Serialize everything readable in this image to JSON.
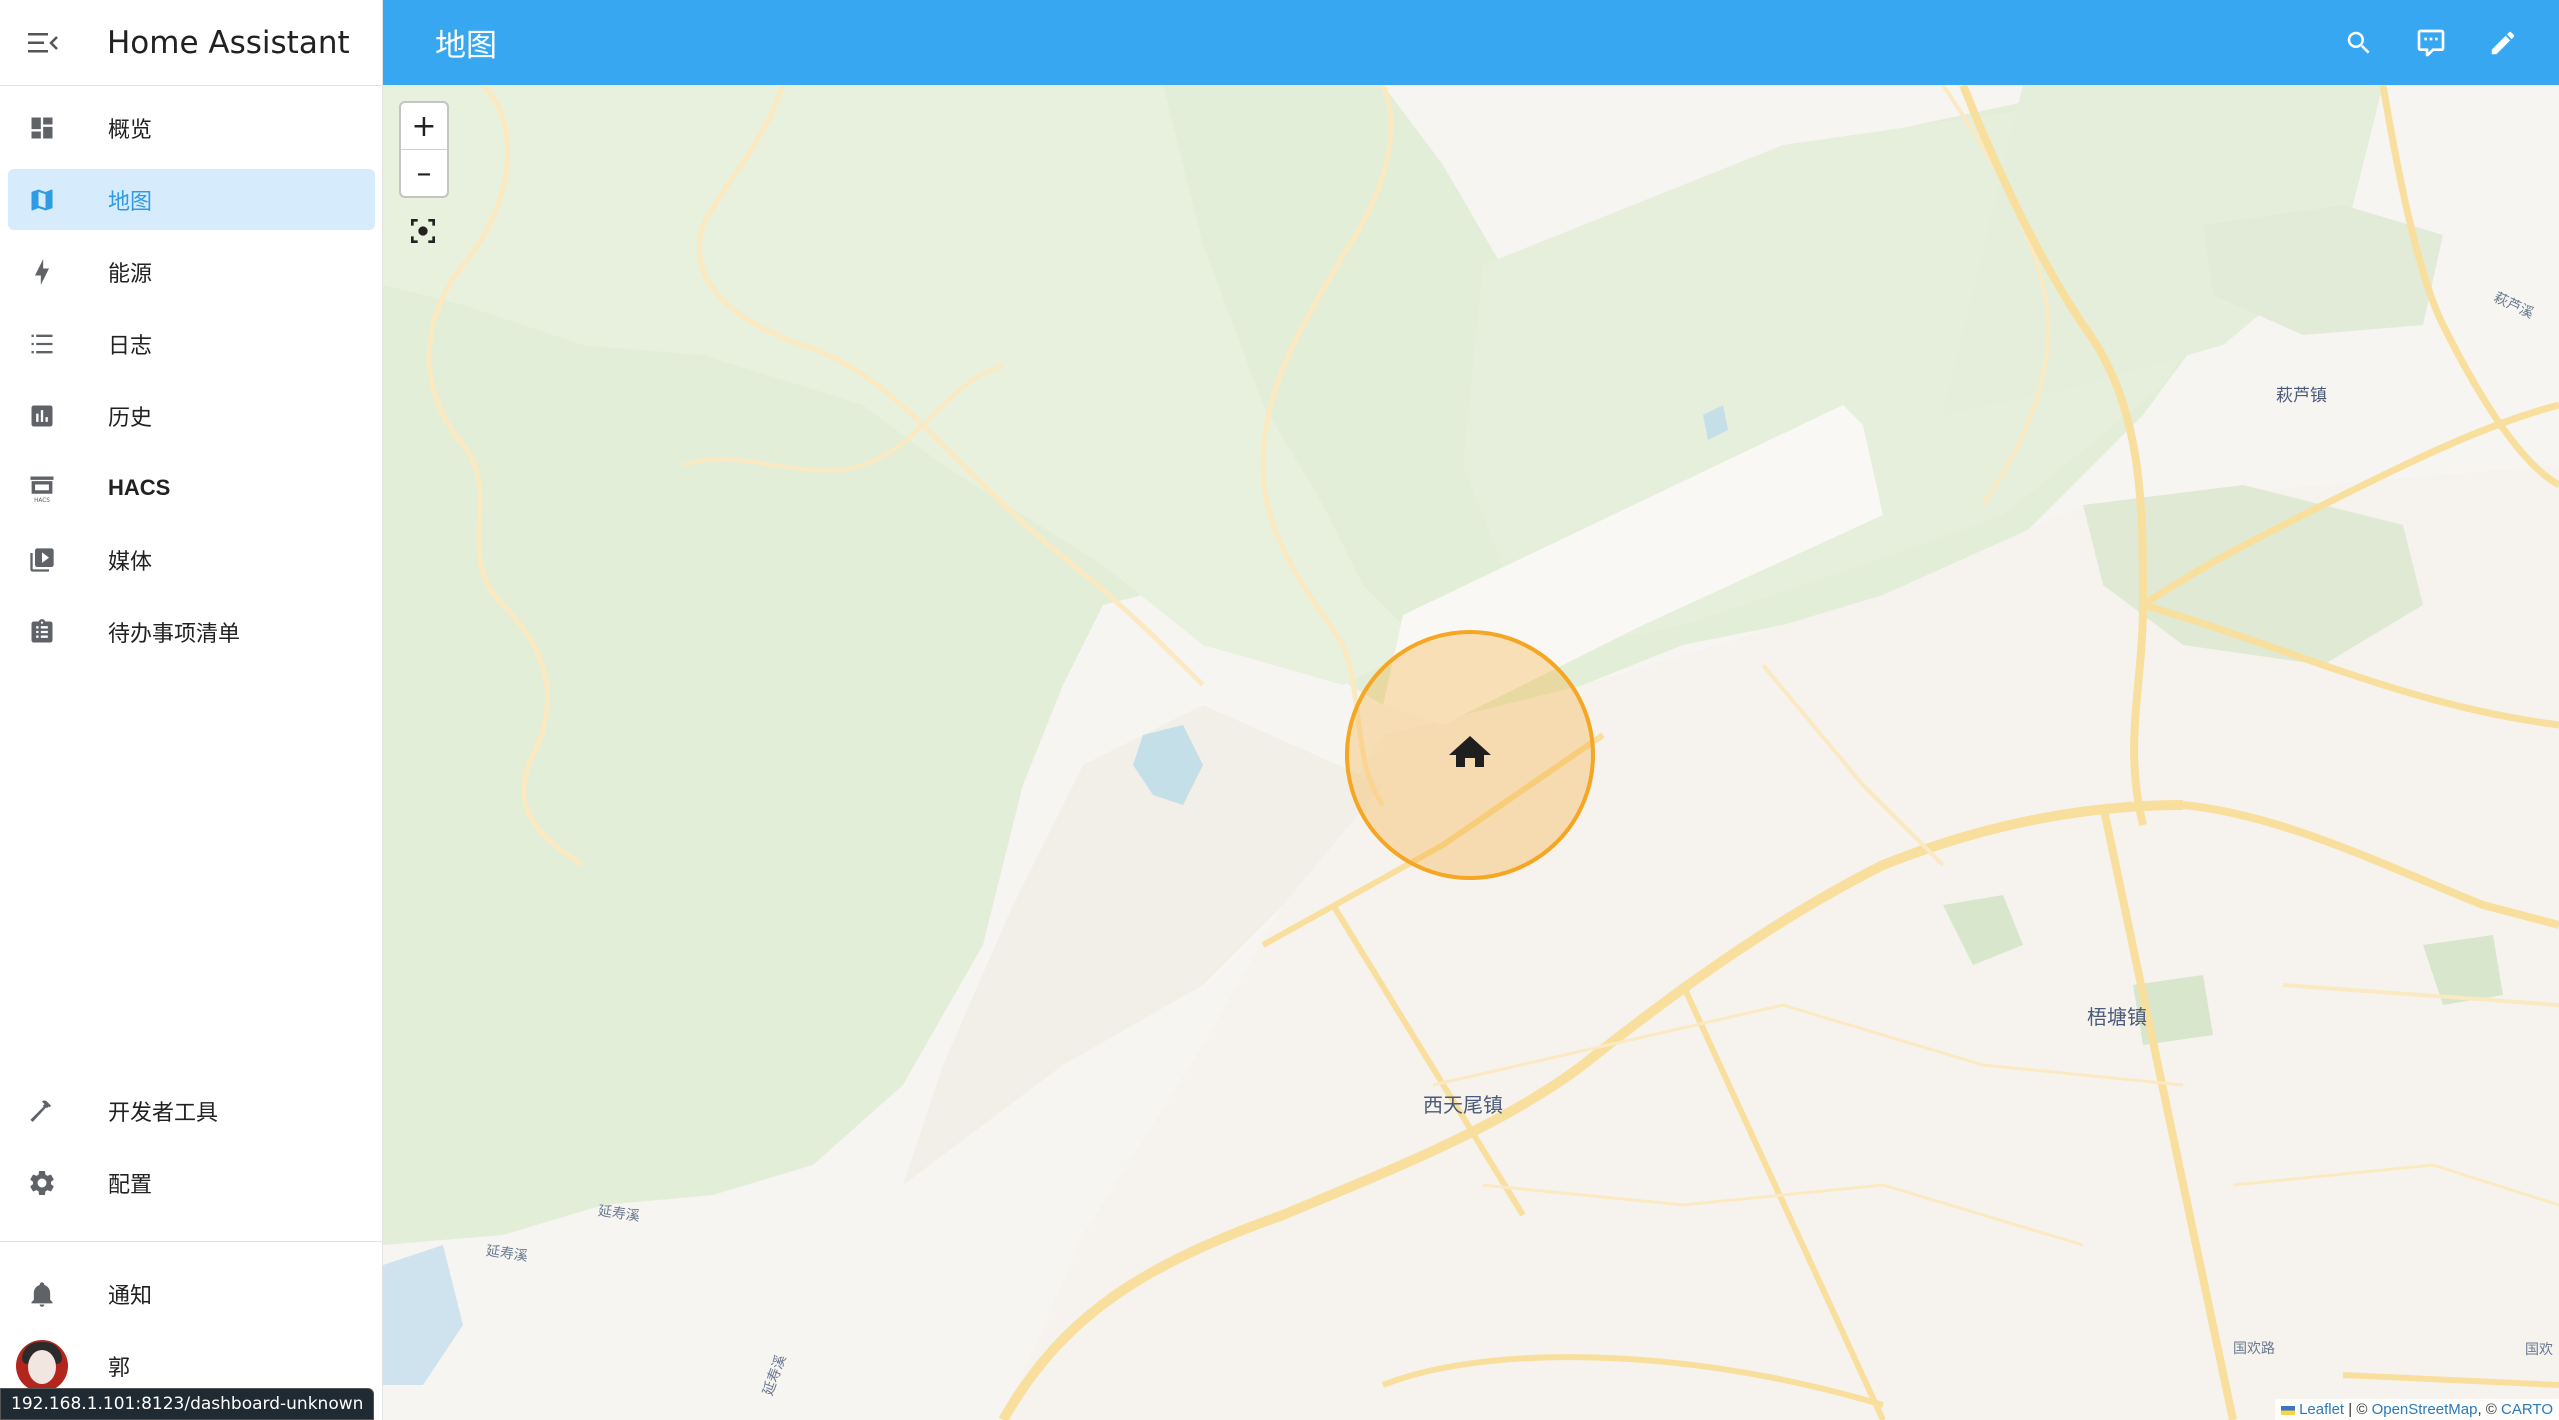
{
  "app": {
    "title": "Home Assistant"
  },
  "sidebar": {
    "items": [
      {
        "label": "概览",
        "icon": "dashboard-icon"
      },
      {
        "label": "地图",
        "icon": "map-icon",
        "active": true
      },
      {
        "label": "能源",
        "icon": "lightning-bolt-icon"
      },
      {
        "label": "日志",
        "icon": "list-icon"
      },
      {
        "label": "历史",
        "icon": "chart-bar-icon"
      },
      {
        "label": "HACS",
        "icon": "hacs-store-icon"
      },
      {
        "label": "媒体",
        "icon": "media-library-icon"
      },
      {
        "label": "待办事项清单",
        "icon": "clipboard-list-icon"
      }
    ],
    "bottom_items": [
      {
        "label": "开发者工具",
        "icon": "hammer-icon"
      },
      {
        "label": "配置",
        "icon": "gear-icon"
      }
    ],
    "notifications_label": "通知",
    "user_name": "郭"
  },
  "topbar": {
    "title": "地图",
    "actions": [
      "search-icon",
      "assist-chat-icon",
      "pencil-edit-icon"
    ]
  },
  "map": {
    "zoom_in": "+",
    "zoom_out": "–",
    "places": {
      "xitianwei": "西天尾镇",
      "wutang": "梧塘镇",
      "qiaolu": "萩芦镇",
      "river1": "延寿溪",
      "river2": "延寿溪",
      "river3": "延寿溪",
      "river4": "萩芦溪",
      "road": "国欢路",
      "road2": "国欢"
    },
    "attribution": {
      "leaflet": "Leaflet",
      "sep1": " | © ",
      "osm": "OpenStreetMap",
      "sep2": ", © ",
      "carto": "CARTO"
    },
    "home_zone_color": "#f5a623"
  },
  "status_url": "192.168.1.101:8123/dashboard-unknown"
}
